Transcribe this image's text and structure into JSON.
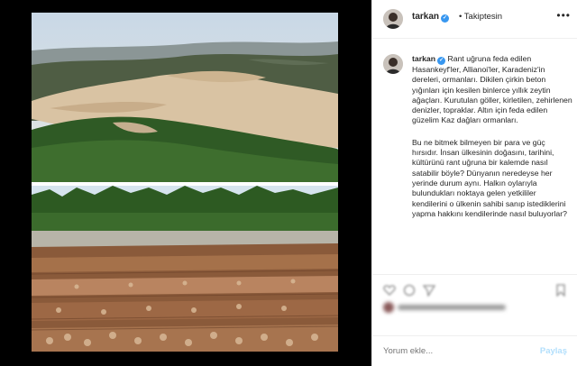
{
  "post": {
    "username": "tarkan",
    "follow_status": "• Takiptesin",
    "more_icon": "more-dots-icon",
    "caption_user": "tarkan",
    "caption_p1": "Rant uğruna feda edilen Hasankeyf'ler, Allianoi'ler, Karadeniz'in dereleri, ormanları. Dikilen çirkin beton yığınları için kesilen binlerce yıllık zeytin ağaçları. Kurutulan göller, kirletilen, zehirlenen denizler, topraklar. Altın için feda edilen güzelim Kaz dağları ormanları.",
    "caption_p2": "Bu ne bitmek bilmeyen bir para ve güç hırsıdır. İnsan ülkesinin doğasını, tarihini, kültürünü rant uğruna bir kalemde nasıl satabilir böyle? Dünyanın neredeyse her yerinde durum aynı. Halkın oylarıyla bulundukları noktaya gelen yetkililer kendilerini o ülkenin sahibi sanıp istediklerini yapma hakkını kendilerinde nasıl buluyorlar?"
  },
  "comment": {
    "placeholder": "Yorum ekle...",
    "share_label": "Paylaş"
  },
  "icons": [
    "heart-icon",
    "comment-icon",
    "share-icon",
    "bookmark-icon",
    "verified-badge-icon"
  ],
  "colors": {
    "verified": "#3897f0",
    "share_disabled": "#b2dffc"
  }
}
